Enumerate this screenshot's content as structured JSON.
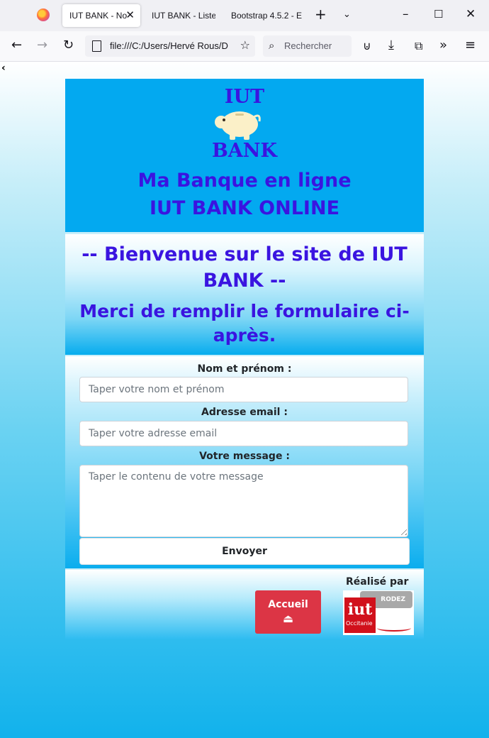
{
  "browser": {
    "tabs": [
      {
        "label": "IUT BANK - No",
        "active": true
      },
      {
        "label": "IUT BANK - Liste d",
        "active": false
      },
      {
        "label": "Bootstrap 4.5.2 - E",
        "active": false
      }
    ],
    "url": "file:///C:/Users/Hervé Rous/D",
    "search_placeholder": "Rechercher"
  },
  "header": {
    "logo_top": "IUT",
    "logo_bottom": "BANK",
    "title": "Ma Banque en ligne",
    "subtitle": "IUT BANK ONLINE"
  },
  "welcome": {
    "line1": "-- Bienvenue sur le site de IUT BANK --",
    "line2": "Merci de remplir le formulaire ci-après."
  },
  "form": {
    "name_label": "Nom et prénom :",
    "name_placeholder": "Taper votre nom et prénom",
    "email_label": "Adresse email :",
    "email_placeholder": "Taper votre adresse email",
    "message_label": "Votre message :",
    "message_placeholder": "Taper le contenu de votre message",
    "submit_label": "Envoyer"
  },
  "footer": {
    "home_label": "Accueil",
    "home_icon": "⏏",
    "credit": "Réalisé par",
    "logo_badge": "RODEZ",
    "logo_text": "iut",
    "logo_sub": "Occitanie"
  },
  "colors": {
    "brand_text": "#3a14e0",
    "header_bg": "#03a9f0",
    "home_button": "#dc3545"
  }
}
